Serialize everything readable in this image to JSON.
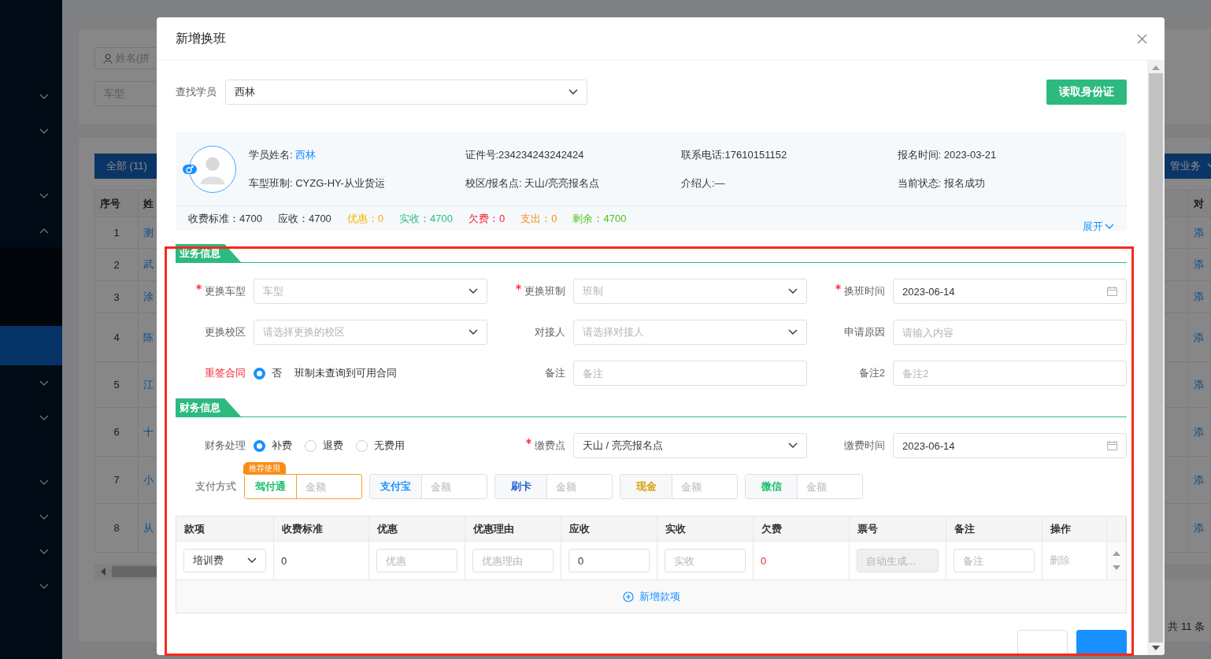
{
  "sidebar": {
    "items": [
      {
        "kind": "menu",
        "expanded": false
      },
      {
        "kind": "menu",
        "expanded": false
      },
      {
        "kind": "blank"
      },
      {
        "kind": "menu",
        "expanded": false
      },
      {
        "kind": "menu",
        "expanded": true
      },
      {
        "kind": "sub",
        "selected": false
      },
      {
        "kind": "sub",
        "selected": false
      },
      {
        "kind": "sub",
        "selected": true
      },
      {
        "kind": "menu",
        "expanded": false
      },
      {
        "kind": "menu",
        "expanded": false
      },
      {
        "kind": "blank"
      },
      {
        "kind": "menu",
        "expanded": false
      },
      {
        "kind": "menu",
        "expanded": false
      },
      {
        "kind": "menu",
        "expanded": false
      },
      {
        "kind": "menu",
        "expanded": false
      }
    ]
  },
  "list_page": {
    "search": {
      "placeholder": "姓名(拼"
    },
    "car_type": {
      "placeholder": "车型"
    },
    "tab": {
      "label": "全部 (11)",
      "selected": true
    },
    "action_button": "管业务",
    "table": {
      "columns": [
        "序号",
        "姓",
        "对"
      ],
      "rows": [
        [
          "1",
          "测",
          "添"
        ],
        [
          "2",
          "武",
          "添"
        ],
        [
          "3",
          "涂",
          "添"
        ],
        [
          "4",
          "陈",
          "添"
        ],
        [
          "5",
          "江",
          "添"
        ],
        [
          "6",
          "十",
          "添"
        ],
        [
          "7",
          "小",
          "添"
        ],
        [
          "8",
          "从",
          "添"
        ]
      ]
    },
    "total": "共 11 条"
  },
  "dialog": {
    "title": "新增换班",
    "student_search": {
      "label": "查找学员",
      "value": "西林"
    },
    "read_id_button": "读取身份证",
    "student_card": {
      "fields": [
        {
          "label": "学员姓名:",
          "value": "西林",
          "kind": "link"
        },
        {
          "text": "证件号:234234243242424",
          "kind": "text"
        },
        {
          "text": "联系电话:17610151152",
          "kind": "text"
        },
        {
          "text": "报名时间: 2023-03-21",
          "kind": "text"
        },
        {
          "text": "车型班制: CYZG-HY-从业货运",
          "kind": "text"
        },
        {
          "text": "校区/报名点: 天山/亮亮报名点",
          "kind": "text"
        },
        {
          "text": "介绍人:—",
          "kind": "text"
        },
        {
          "text": "当前状态: 报名成功",
          "kind": "text"
        }
      ],
      "fees": [
        {
          "text": "收费标准：4700",
          "color": "#333333"
        },
        {
          "text": "应收：4700",
          "color": "#333333"
        },
        {
          "text": "优惠：0",
          "color": "#f5b400"
        },
        {
          "text": "实收：4700",
          "color": "#2dba7e"
        },
        {
          "text": "欠费：0",
          "color": "#f5222d"
        },
        {
          "text": "支出：0",
          "color": "#fa8c16"
        },
        {
          "text": "剩余：4700",
          "color": "#52c41a"
        }
      ],
      "expand_link": "展开"
    },
    "sections": [
      {
        "title": "业务信息",
        "fields": [
          {
            "label": "更换车型",
            "required": true,
            "kind": "select",
            "placeholder": "车型"
          },
          {
            "label": "更换班制",
            "required": true,
            "kind": "select",
            "placeholder": "班制"
          },
          {
            "label": "换班时间",
            "required": true,
            "kind": "date",
            "value": "2023-06-14"
          },
          {
            "label": "更换校区",
            "required": false,
            "kind": "select",
            "placeholder": "请选择更换的校区"
          },
          {
            "label": "对接人",
            "required": false,
            "kind": "select",
            "placeholder": "请选择对接人"
          },
          {
            "label": "申请原因",
            "required": false,
            "kind": "input",
            "placeholder": "请输入内容"
          },
          {
            "label": "重签合同",
            "required": false,
            "alert": true,
            "kind": "radio",
            "options": [
              {
                "label": "否",
                "selected": true
              }
            ],
            "note": "班制未查询到可用合同"
          },
          {
            "label": "备注",
            "required": false,
            "kind": "input",
            "placeholder": "备注"
          },
          {
            "label": "备注2",
            "required": false,
            "kind": "input",
            "placeholder": "备注2"
          }
        ]
      },
      {
        "title": "财务信息",
        "fields": [
          {
            "label": "财务处理",
            "required": false,
            "kind": "radio",
            "options": [
              {
                "label": "补费",
                "selected": true
              },
              {
                "label": "退费",
                "selected": false
              },
              {
                "label": "无费用",
                "selected": false
              }
            ]
          },
          {
            "label": "缴费点",
            "required": true,
            "kind": "select",
            "value": "天山 / 亮亮报名点"
          },
          {
            "label": "缴费时间",
            "required": false,
            "kind": "date",
            "value": "2023-06-14"
          }
        ]
      }
    ],
    "payment": {
      "label": "支付方式",
      "methods": [
        {
          "name": "驾付通",
          "color": "#19be6b",
          "placeholder": "金额",
          "recommended": true,
          "badge": "推荐使用"
        },
        {
          "name": "支付宝",
          "color": "#1890ff",
          "placeholder": "金额",
          "recommended": false
        },
        {
          "name": "刷卡",
          "color": "#1d5fd6",
          "placeholder": "金额",
          "recommended": false
        },
        {
          "name": "现金",
          "color": "#d4a106",
          "placeholder": "金额",
          "recommended": false
        },
        {
          "name": "微信",
          "color": "#19be6b",
          "placeholder": "金额",
          "recommended": false
        }
      ]
    },
    "items_table": {
      "columns": [
        "款项",
        "收费标准",
        "优惠",
        "优惠理由",
        "应收",
        "实收",
        "欠费",
        "票号",
        "备注",
        "操作"
      ],
      "rows": [
        [
          {
            "kind": "select",
            "value": "培训费"
          },
          {
            "kind": "text",
            "value": "0"
          },
          {
            "kind": "input",
            "placeholder": "优惠"
          },
          {
            "kind": "input",
            "placeholder": "优惠理由"
          },
          {
            "kind": "input",
            "value": "0"
          },
          {
            "kind": "input",
            "placeholder": "实收"
          },
          {
            "kind": "alert",
            "value": "0"
          },
          {
            "kind": "input",
            "placeholder": "自动生成...",
            "disabled": true
          },
          {
            "kind": "input",
            "placeholder": "备注"
          },
          {
            "kind": "link",
            "value": "删除",
            "disabled": true
          }
        ]
      ],
      "add_row": "新增款项"
    },
    "footer_buttons": [
      {
        "kind": "default"
      },
      {
        "kind": "primary"
      }
    ]
  }
}
